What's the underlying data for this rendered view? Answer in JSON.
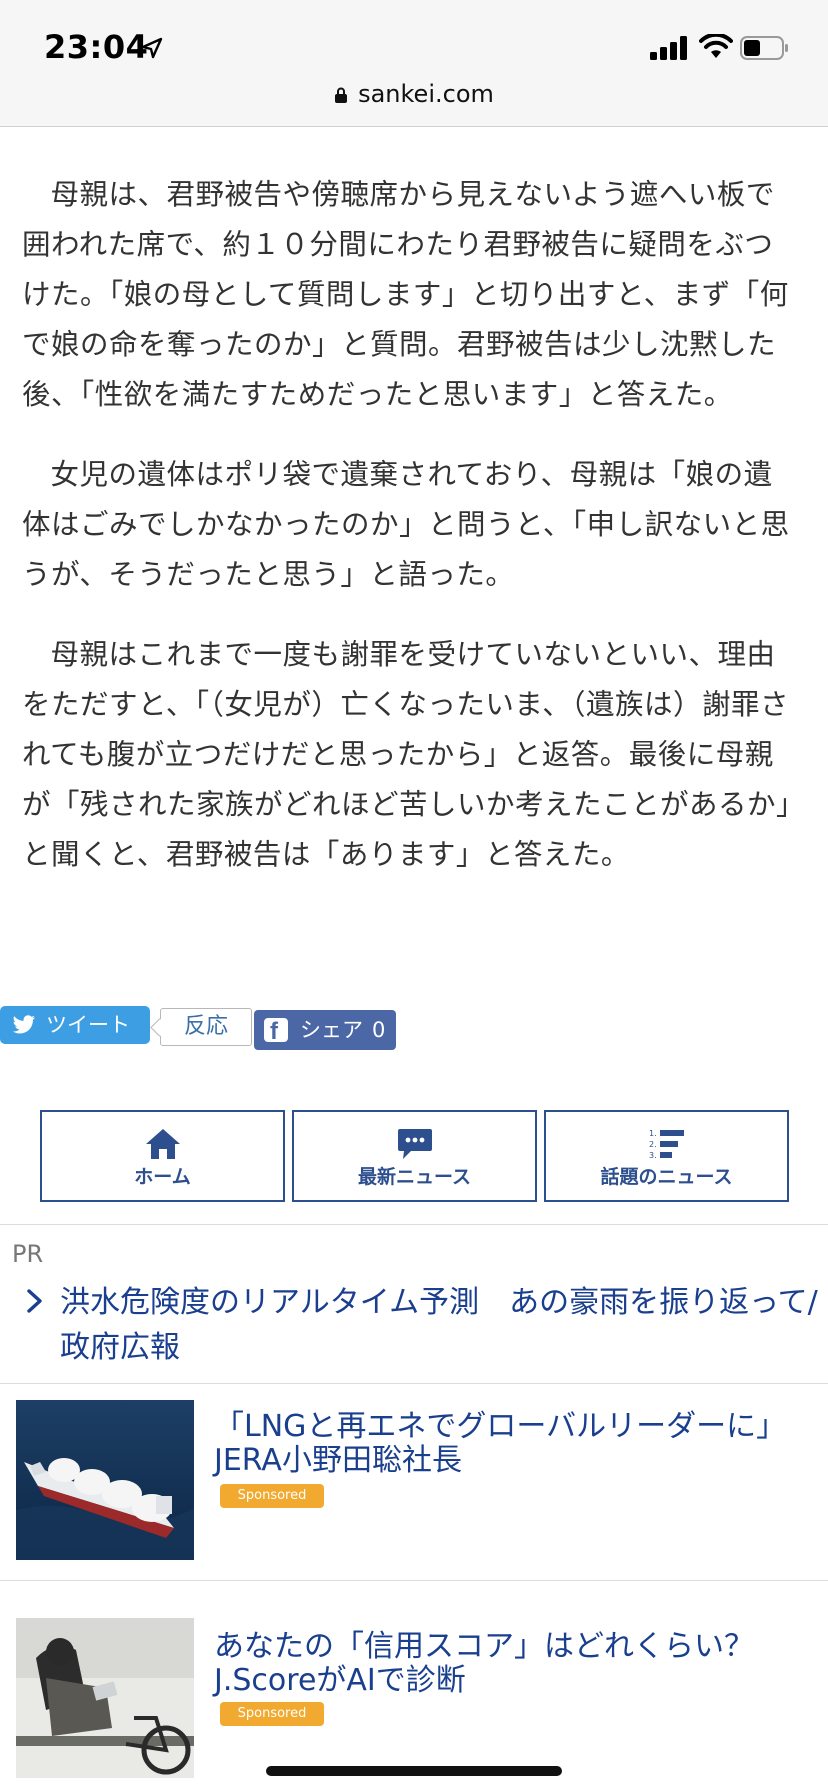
{
  "status_bar": {
    "time": "23:04"
  },
  "browser": {
    "url": "sankei.com"
  },
  "article": {
    "paragraphs": [
      "母親は、君野被告や傍聴席から見えないよう遮へい板で囲われた席で、約１０分間にわたり君野被告に疑問をぶつけた。「娘の母として質問します」と切り出すと、まず「何で娘の命を奪ったのか」と質問。君野被告は少し沈黙した後、「性欲を満たすためだったと思います」と答えた。",
      "女児の遺体はポリ袋で遺棄されており、母親は「娘の遺体はごみでしかなかったのか」と問うと、「申し訳ないと思うが、そうだったと思う」と語った。",
      "母親はこれまで一度も謝罪を受けていないといい、理由をただすと、「（女児が）亡くなったいま、（遺族は）謝罪されても腹が立つだけだと思ったから」と返答。最後に母親が「残された家族がどれほど苦しいか考えたことがあるか」と聞くと、君野被告は「あります」と答えた。"
    ]
  },
  "share": {
    "tweet_label": "ツイート",
    "reaction_label": "反応",
    "facebook_label": "シェア",
    "facebook_count": "0"
  },
  "nav": {
    "items": [
      {
        "label": "ホーム",
        "icon": "home-icon"
      },
      {
        "label": "最新ニュース",
        "icon": "chat-bubble-icon"
      },
      {
        "label": "話題のニュース",
        "icon": "ranked-list-icon"
      }
    ]
  },
  "pr": {
    "label": "PR",
    "link_text": "洪水危険度のリアルタイム予測　あの豪雨を振り返って/政府広報"
  },
  "ads": [
    {
      "title": "「LNGと再エネでグローバルリーダーに」JERA小野田聡社長",
      "badge": "Sponsored"
    },
    {
      "title": "あなたの「信用スコア」はどれくらい？　J.ScoreがAIで診断",
      "badge": "Sponsored"
    }
  ],
  "colors": {
    "link_blue": "#1a3f8f",
    "nav_blue": "#2d4f8e",
    "twitter_blue": "#3d9ee4",
    "facebook_blue": "#4b67a6",
    "sponsored_orange": "#f1a92f"
  }
}
